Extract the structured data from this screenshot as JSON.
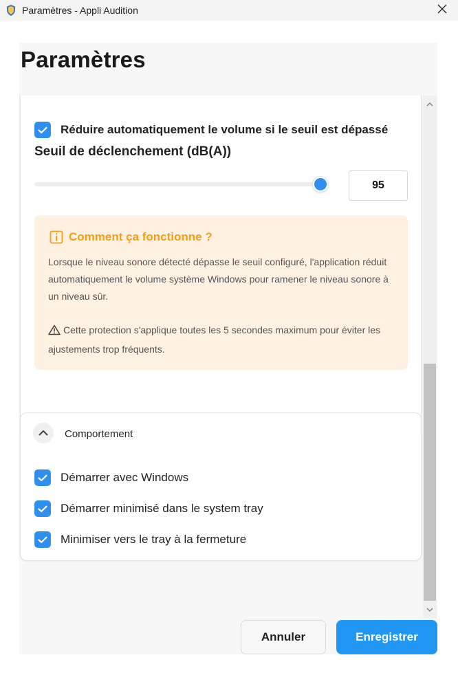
{
  "window": {
    "title": "Paramètres - Appli Audition"
  },
  "page": {
    "title": "Paramètres"
  },
  "protection": {
    "auto_reduce_label": "Réduire automatiquement le volume si le seuil est dépassé",
    "auto_reduce_checked": true,
    "threshold_label": "Seuil de déclenchement (dB(A))",
    "threshold_value": "95",
    "slider_fraction": 0.98,
    "info": {
      "title": "Comment ça fonctionne ?",
      "text": "Lorsque le niveau sonore détecté dépasse le seuil configuré, l'application réduit automatiquement le volume système Windows pour ramener le niveau sonore à un niveau sûr.",
      "warning": "Cette protection s'applique toutes les 5 secondes maximum pour éviter les ajustements trop fréquents."
    }
  },
  "behavior": {
    "title": "Comportement",
    "items": [
      {
        "label": "Démarrer avec Windows",
        "checked": true
      },
      {
        "label": "Démarrer minimisé dans le system tray",
        "checked": true
      },
      {
        "label": "Minimiser vers le tray à la fermeture",
        "checked": true
      }
    ]
  },
  "footer": {
    "cancel_label": "Annuler",
    "save_label": "Enregistrer"
  },
  "colors": {
    "accent": "#2196f3",
    "checkbox": "#2f8fef",
    "info_bg": "#fff1e2",
    "info_title": "#f3a012"
  },
  "icons": {
    "app": "shield-icon",
    "close": "close-icon",
    "info": "info-icon",
    "warning": "warning-icon",
    "collapse": "chevron-up-icon"
  }
}
